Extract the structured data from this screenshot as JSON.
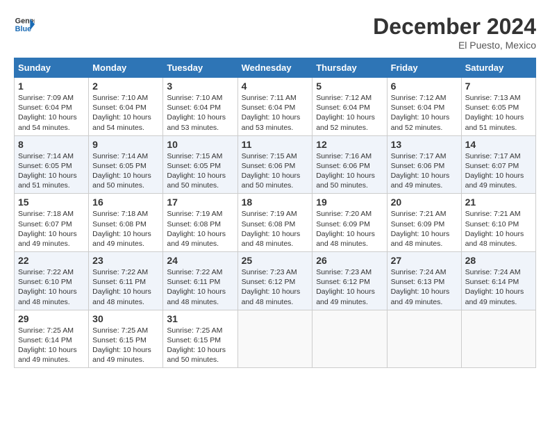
{
  "logo": {
    "line1": "General",
    "line2": "Blue"
  },
  "title": "December 2024",
  "location": "El Puesto, Mexico",
  "days_of_week": [
    "Sunday",
    "Monday",
    "Tuesday",
    "Wednesday",
    "Thursday",
    "Friday",
    "Saturday"
  ],
  "weeks": [
    [
      {
        "day": "1",
        "info": "Sunrise: 7:09 AM\nSunset: 6:04 PM\nDaylight: 10 hours\nand 54 minutes."
      },
      {
        "day": "2",
        "info": "Sunrise: 7:10 AM\nSunset: 6:04 PM\nDaylight: 10 hours\nand 54 minutes."
      },
      {
        "day": "3",
        "info": "Sunrise: 7:10 AM\nSunset: 6:04 PM\nDaylight: 10 hours\nand 53 minutes."
      },
      {
        "day": "4",
        "info": "Sunrise: 7:11 AM\nSunset: 6:04 PM\nDaylight: 10 hours\nand 53 minutes."
      },
      {
        "day": "5",
        "info": "Sunrise: 7:12 AM\nSunset: 6:04 PM\nDaylight: 10 hours\nand 52 minutes."
      },
      {
        "day": "6",
        "info": "Sunrise: 7:12 AM\nSunset: 6:04 PM\nDaylight: 10 hours\nand 52 minutes."
      },
      {
        "day": "7",
        "info": "Sunrise: 7:13 AM\nSunset: 6:05 PM\nDaylight: 10 hours\nand 51 minutes."
      }
    ],
    [
      {
        "day": "8",
        "info": "Sunrise: 7:14 AM\nSunset: 6:05 PM\nDaylight: 10 hours\nand 51 minutes."
      },
      {
        "day": "9",
        "info": "Sunrise: 7:14 AM\nSunset: 6:05 PM\nDaylight: 10 hours\nand 50 minutes."
      },
      {
        "day": "10",
        "info": "Sunrise: 7:15 AM\nSunset: 6:05 PM\nDaylight: 10 hours\nand 50 minutes."
      },
      {
        "day": "11",
        "info": "Sunrise: 7:15 AM\nSunset: 6:06 PM\nDaylight: 10 hours\nand 50 minutes."
      },
      {
        "day": "12",
        "info": "Sunrise: 7:16 AM\nSunset: 6:06 PM\nDaylight: 10 hours\nand 50 minutes."
      },
      {
        "day": "13",
        "info": "Sunrise: 7:17 AM\nSunset: 6:06 PM\nDaylight: 10 hours\nand 49 minutes."
      },
      {
        "day": "14",
        "info": "Sunrise: 7:17 AM\nSunset: 6:07 PM\nDaylight: 10 hours\nand 49 minutes."
      }
    ],
    [
      {
        "day": "15",
        "info": "Sunrise: 7:18 AM\nSunset: 6:07 PM\nDaylight: 10 hours\nand 49 minutes."
      },
      {
        "day": "16",
        "info": "Sunrise: 7:18 AM\nSunset: 6:08 PM\nDaylight: 10 hours\nand 49 minutes."
      },
      {
        "day": "17",
        "info": "Sunrise: 7:19 AM\nSunset: 6:08 PM\nDaylight: 10 hours\nand 49 minutes."
      },
      {
        "day": "18",
        "info": "Sunrise: 7:19 AM\nSunset: 6:08 PM\nDaylight: 10 hours\nand 48 minutes."
      },
      {
        "day": "19",
        "info": "Sunrise: 7:20 AM\nSunset: 6:09 PM\nDaylight: 10 hours\nand 48 minutes."
      },
      {
        "day": "20",
        "info": "Sunrise: 7:21 AM\nSunset: 6:09 PM\nDaylight: 10 hours\nand 48 minutes."
      },
      {
        "day": "21",
        "info": "Sunrise: 7:21 AM\nSunset: 6:10 PM\nDaylight: 10 hours\nand 48 minutes."
      }
    ],
    [
      {
        "day": "22",
        "info": "Sunrise: 7:22 AM\nSunset: 6:10 PM\nDaylight: 10 hours\nand 48 minutes."
      },
      {
        "day": "23",
        "info": "Sunrise: 7:22 AM\nSunset: 6:11 PM\nDaylight: 10 hours\nand 48 minutes."
      },
      {
        "day": "24",
        "info": "Sunrise: 7:22 AM\nSunset: 6:11 PM\nDaylight: 10 hours\nand 48 minutes."
      },
      {
        "day": "25",
        "info": "Sunrise: 7:23 AM\nSunset: 6:12 PM\nDaylight: 10 hours\nand 48 minutes."
      },
      {
        "day": "26",
        "info": "Sunrise: 7:23 AM\nSunset: 6:12 PM\nDaylight: 10 hours\nand 49 minutes."
      },
      {
        "day": "27",
        "info": "Sunrise: 7:24 AM\nSunset: 6:13 PM\nDaylight: 10 hours\nand 49 minutes."
      },
      {
        "day": "28",
        "info": "Sunrise: 7:24 AM\nSunset: 6:14 PM\nDaylight: 10 hours\nand 49 minutes."
      }
    ],
    [
      {
        "day": "29",
        "info": "Sunrise: 7:25 AM\nSunset: 6:14 PM\nDaylight: 10 hours\nand 49 minutes."
      },
      {
        "day": "30",
        "info": "Sunrise: 7:25 AM\nSunset: 6:15 PM\nDaylight: 10 hours\nand 49 minutes."
      },
      {
        "day": "31",
        "info": "Sunrise: 7:25 AM\nSunset: 6:15 PM\nDaylight: 10 hours\nand 50 minutes."
      },
      {
        "day": "",
        "info": ""
      },
      {
        "day": "",
        "info": ""
      },
      {
        "day": "",
        "info": ""
      },
      {
        "day": "",
        "info": ""
      }
    ]
  ]
}
